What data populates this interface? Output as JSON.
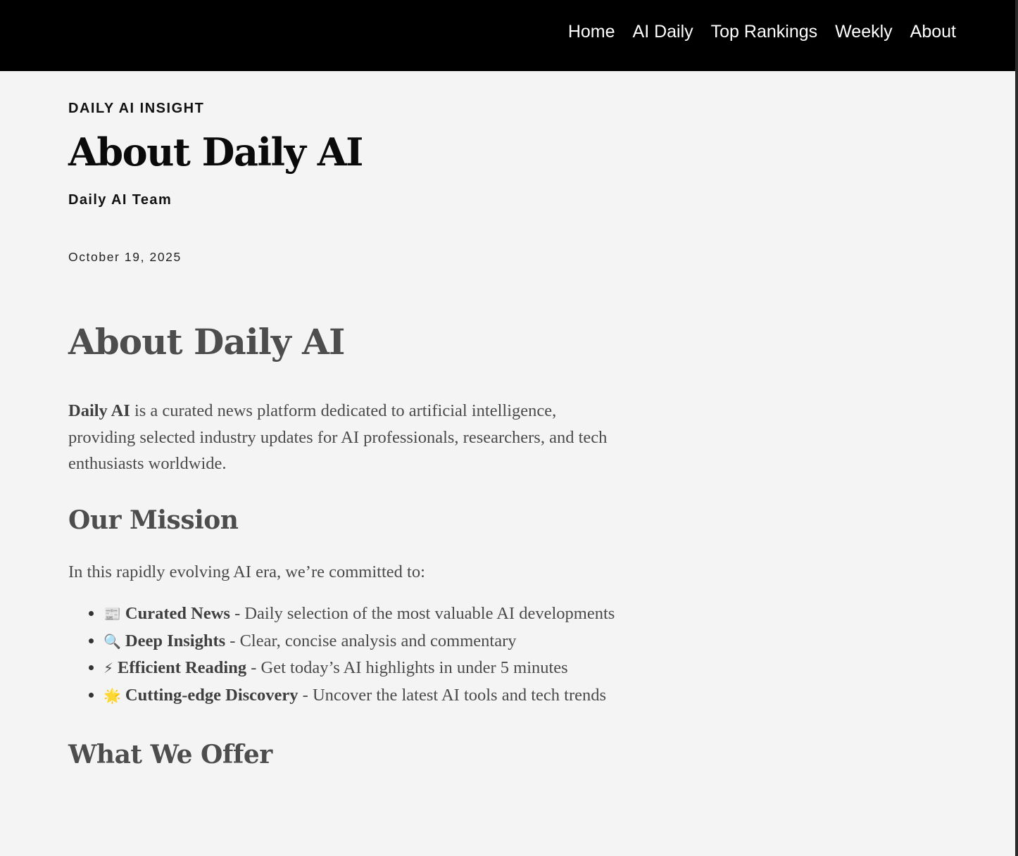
{
  "nav": {
    "items": [
      "Home",
      "AI Daily",
      "Top Rankings",
      "Weekly",
      "About"
    ]
  },
  "post": {
    "kicker": "DAILY AI INSIGHT",
    "title": "About Daily AI",
    "author": "Daily AI Team",
    "date": "October 19, 2025"
  },
  "article": {
    "heading": "About Daily AI",
    "intro_bold": "Daily AI",
    "intro_rest": " is a curated news platform dedicated to artificial intelligence, providing selected industry updates for AI professionals, researchers, and tech enthusiasts worldwide.",
    "mission_heading": "Our Mission",
    "mission_lead": "In this rapidly evolving AI era, we’re committed to:",
    "mission_items": [
      {
        "icon": "📰",
        "title": "Curated News",
        "text": " - Daily selection of the most valuable AI developments"
      },
      {
        "icon": "🔍",
        "title": "Deep Insights",
        "text": " - Clear, concise analysis and commentary"
      },
      {
        "icon": "⚡",
        "title": "Efficient Reading",
        "text": " - Get today’s AI highlights in under 5 minutes"
      },
      {
        "icon": "🌟",
        "title": "Cutting-edge Discovery",
        "text": " - Uncover the latest AI tools and tech trends"
      }
    ],
    "offer_heading": "What We Offer"
  },
  "colors": {
    "topbar": "#000000",
    "background": "#f4f4f4",
    "body_text": "#4a4a4a"
  }
}
